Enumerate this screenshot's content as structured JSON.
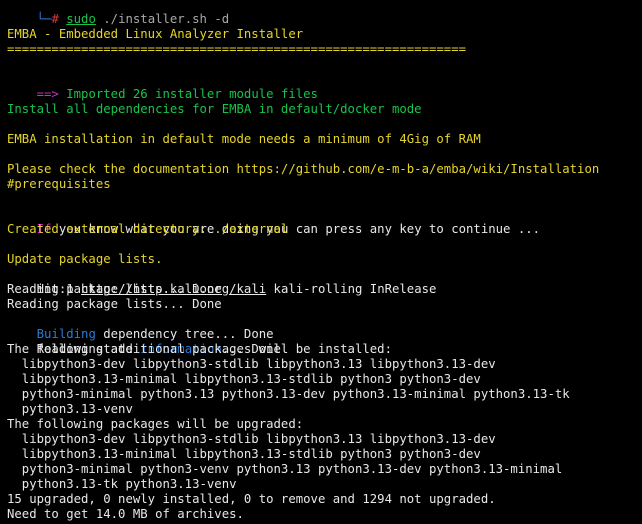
{
  "prompt": {
    "corner": "└─",
    "symbol": "#",
    "sudo": "sudo",
    "command": " ./installer.sh -d"
  },
  "header": {
    "title": "EMBA - Embedded Linux Analyzer Installer",
    "rule": "=============================================================="
  },
  "messages": {
    "imported_arrow": "==>",
    "imported_text": " Imported 26 installer module files",
    "install_all": "Install all dependencies for EMBA in default/docker mode",
    "min_ram": "EMBA installation in default mode needs a minimum of 4Gig of RAM",
    "doc_line1": "Please check the documentation https://github.com/e-m-b-a/emba/wiki/Installation",
    "doc_line2": "#prerequisites",
    "continue_if": "If",
    "continue_rest": " you know what you are doing you can press any key to continue ...",
    "created_dir": "Created external directory: ./external",
    "update_lists": "Update package lists."
  },
  "apt": {
    "hit_prefix": "Hit:1 ",
    "hit_url": "http://http.kali.org/kali",
    "hit_suffix": " kali-rolling InRelease",
    "reading1": "Reading package lists... Done",
    "reading2": "Reading package lists... Done",
    "building_word": "Building",
    "building_rest": " dependency tree... Done",
    "state_prefix": "Reading state ",
    "state_word": "information",
    "state_suffix": "... Done",
    "additional_header": "The following additional packages will be installed:",
    "additional": [
      "  libpython3-dev libpython3-stdlib libpython3.13 libpython3.13-dev",
      "  libpython3.13-minimal libpython3.13-stdlib python3 python3-dev",
      "  python3-minimal python3.13 python3.13-dev python3.13-minimal python3.13-tk",
      "  python3.13-venv"
    ],
    "upgraded_header": "The following packages will be upgraded:",
    "upgraded": [
      "  libpython3-dev libpython3-stdlib libpython3.13 libpython3.13-dev",
      "  libpython3.13-minimal libpython3.13-stdlib python3 python3-dev",
      "  python3-minimal python3-venv python3.13 python3.13-dev python3.13-minimal",
      "  python3.13-tk python3.13-venv"
    ],
    "summary": "15 upgraded, 0 newly installed, 0 to remove and 1294 not upgraded.",
    "need": "Need to get 14.0 MB of archives."
  },
  "colors": {
    "background": "#000000",
    "text": "#e8e8e8",
    "yellow": "#e6d52a",
    "green": "#19c24b",
    "blue": "#2a7bd6",
    "magenta": "#d02ad0",
    "red": "#d33a3a"
  }
}
